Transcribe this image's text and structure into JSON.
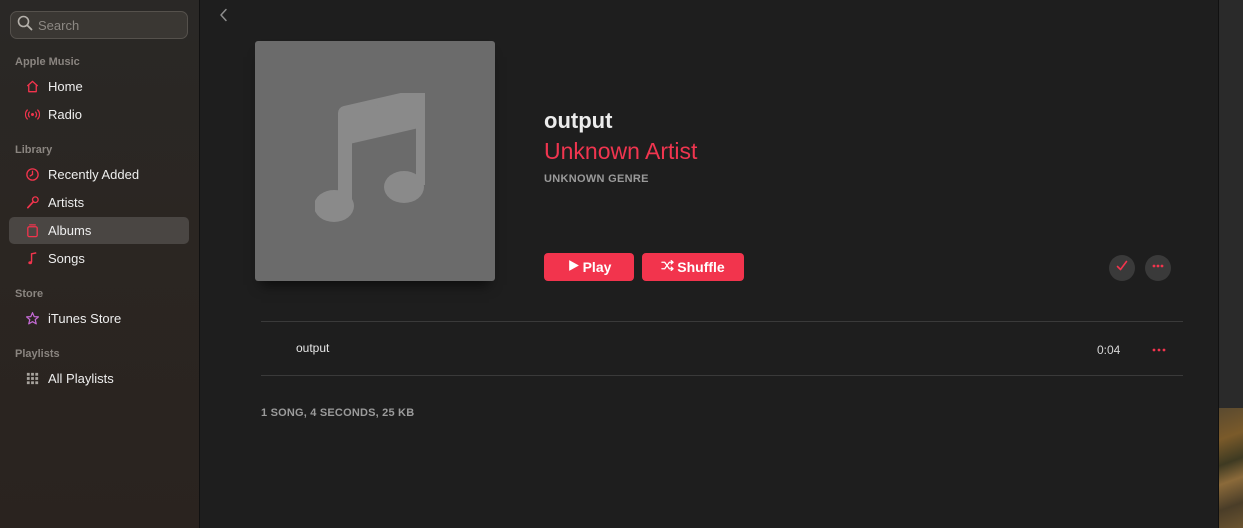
{
  "search": {
    "placeholder": "Search"
  },
  "sidebar": {
    "sections": [
      {
        "label": "Apple Music"
      },
      {
        "label": "Library"
      },
      {
        "label": "Store"
      },
      {
        "label": "Playlists"
      }
    ],
    "items": [
      {
        "label": "Home",
        "icon": "home-icon"
      },
      {
        "label": "Radio",
        "icon": "radio-icon"
      },
      {
        "label": "Recently Added",
        "icon": "clock-icon"
      },
      {
        "label": "Artists",
        "icon": "microphone-icon"
      },
      {
        "label": "Albums",
        "icon": "album-icon",
        "active": true
      },
      {
        "label": "Songs",
        "icon": "music-note-icon"
      },
      {
        "label": "iTunes Store",
        "icon": "star-icon"
      },
      {
        "label": "All Playlists",
        "icon": "grid-icon"
      }
    ]
  },
  "album": {
    "title": "output",
    "artist": "Unknown Artist",
    "genre": "UNKNOWN GENRE",
    "play_label": "Play",
    "shuffle_label": "Shuffle"
  },
  "tracks": [
    {
      "title": "output",
      "duration": "0:04"
    }
  ],
  "footer": {
    "info": "1 SONG, 4 SECONDS, 25 KB"
  },
  "colors": {
    "accent": "#f2344d",
    "sidebar_bg": "#2a2622",
    "main_bg": "#1e1e1e",
    "artwork_bg": "#6b6b6b"
  }
}
